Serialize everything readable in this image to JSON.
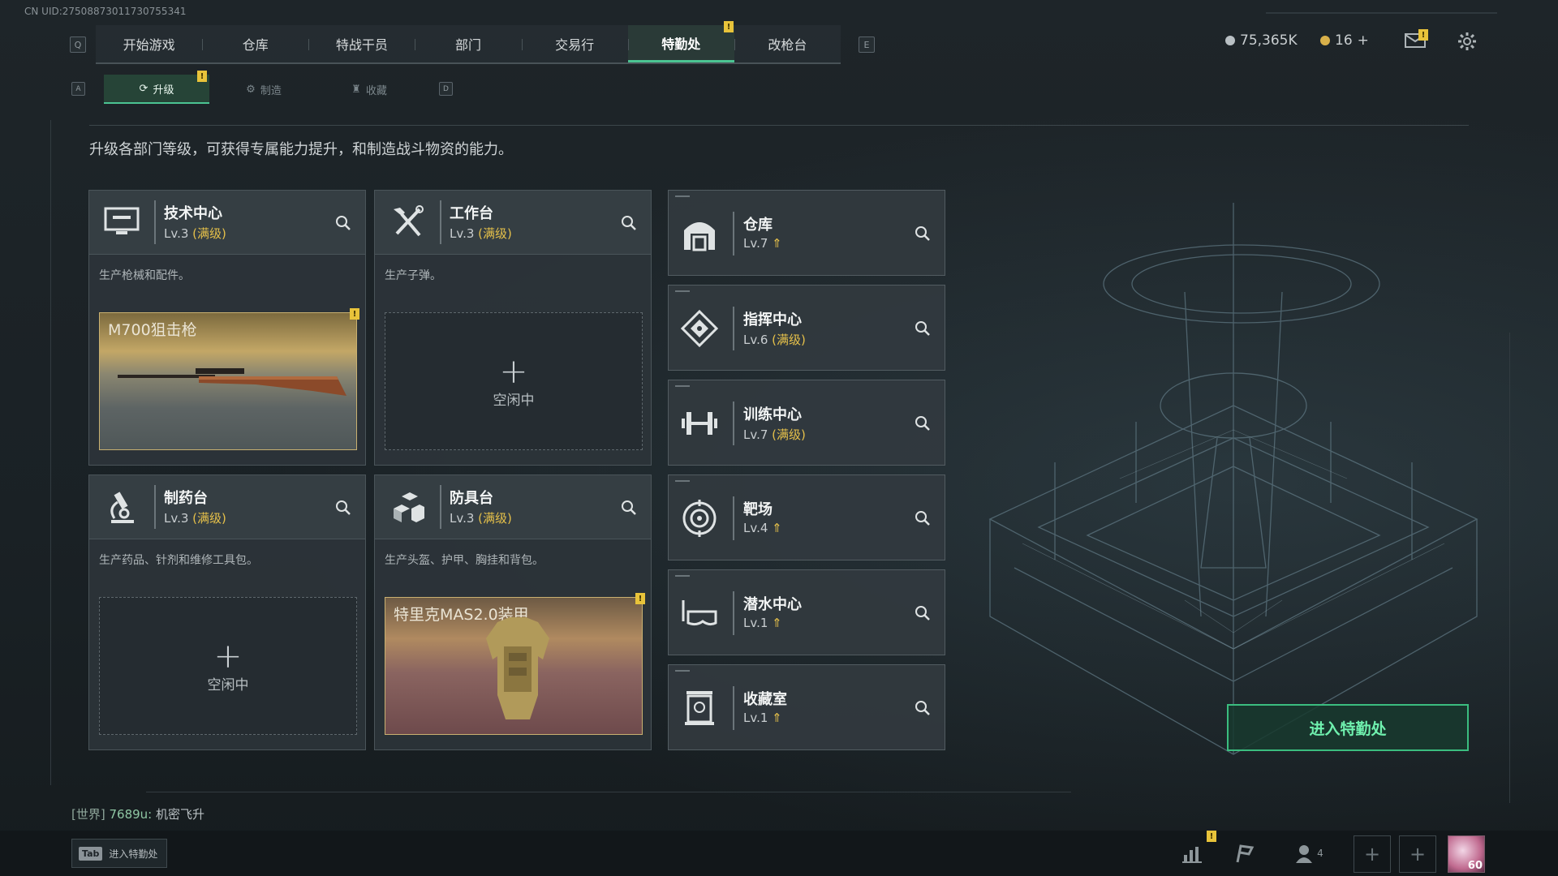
{
  "uid": "CN UID:27508873011730755341",
  "top_tabs": [
    "开始游戏",
    "仓库",
    "特战干员",
    "部门",
    "交易行",
    "特勤处",
    "改枪台"
  ],
  "top_tabs_active": "特勤处",
  "key_left": "Q",
  "key_right": "E",
  "currency": {
    "silver": "75,365K",
    "gold": "16",
    "gold_plus": "+"
  },
  "sub_tabs": [
    {
      "label": "升级",
      "icon": "upgrade-icon"
    },
    {
      "label": "制造",
      "icon": "craft-icon"
    },
    {
      "label": "收藏",
      "icon": "collection-icon"
    }
  ],
  "sub_key_left": "A",
  "sub_key_right": "D",
  "badge_mark": "!",
  "description": "升级各部门等级，可获得专属能力提升，和制造战斗物资的能力。",
  "workshops": [
    {
      "name": "技术中心",
      "level": "Lv.3",
      "max": "(满级)",
      "desc": "生产枪械和配件。",
      "slot": {
        "state": "item",
        "item": "M700狙击枪"
      },
      "icon": "monitor-icon"
    },
    {
      "name": "工作台",
      "level": "Lv.3",
      "max": "(满级)",
      "desc": "生产子弹。",
      "slot": {
        "state": "idle",
        "text": "空闲中"
      },
      "icon": "hammer-wrench-icon"
    },
    {
      "name": "制药台",
      "level": "Lv.3",
      "max": "(满级)",
      "desc": "生产药品、针剂和维修工具包。",
      "slot": {
        "state": "idle",
        "text": "空闲中"
      },
      "icon": "microscope-icon"
    },
    {
      "name": "防具台",
      "level": "Lv.3",
      "max": "(满级)",
      "desc": "生产头盔、护甲、胸挂和背包。",
      "slot": {
        "state": "item",
        "item": "特里克MAS2.0装甲"
      },
      "icon": "cubes-icon"
    }
  ],
  "departments": [
    {
      "name": "仓库",
      "level": "Lv.7",
      "max": "",
      "upgrade": true,
      "icon": "warehouse-icon"
    },
    {
      "name": "指挥中心",
      "level": "Lv.6",
      "max": "(满级)",
      "upgrade": false,
      "icon": "command-icon"
    },
    {
      "name": "训练中心",
      "level": "Lv.7",
      "max": "(满级)",
      "upgrade": false,
      "icon": "dumbbell-icon"
    },
    {
      "name": "靶场",
      "level": "Lv.4",
      "max": "",
      "upgrade": true,
      "icon": "target-icon"
    },
    {
      "name": "潜水中心",
      "level": "Lv.1",
      "max": "",
      "upgrade": true,
      "icon": "diving-mask-icon"
    },
    {
      "name": "收藏室",
      "level": "Lv.1",
      "max": "",
      "upgrade": true,
      "icon": "trophy-case-icon"
    }
  ],
  "enter_button": "进入特勤处",
  "chat": {
    "channel": "[世界]",
    "user": "7689u:",
    "message": "机密飞升"
  },
  "tab_hint": {
    "key": "Tab",
    "label": "进入特勤处"
  },
  "friends_count": "4",
  "player_level": "60",
  "colors": {
    "accent": "#4bc492",
    "gold": "#e5c04a",
    "badge": "#e8c33a"
  }
}
